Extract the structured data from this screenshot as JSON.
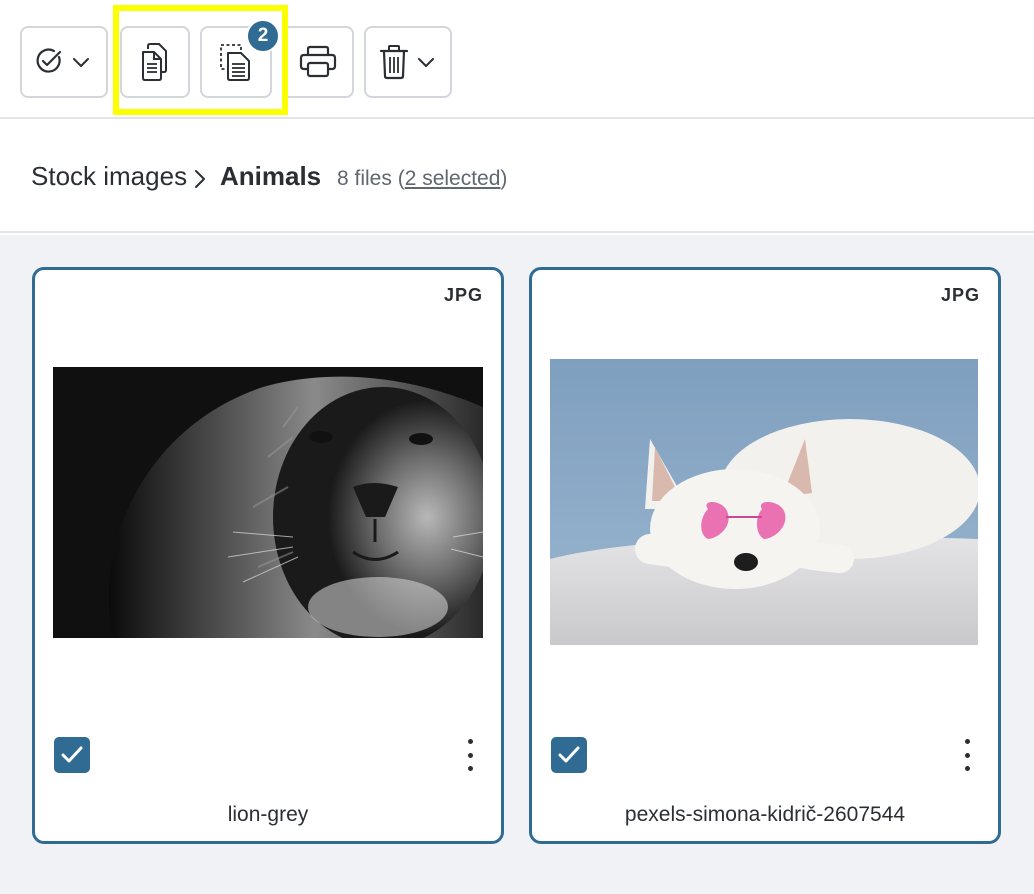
{
  "toolbar": {
    "buttons": [
      {
        "name": "select-all-button",
        "icon": "check-circle-icon",
        "has_dropdown": true
      },
      {
        "name": "copy-button",
        "icon": "copy-documents-icon"
      },
      {
        "name": "copy-selection-button",
        "icon": "dashed-copy-icon",
        "badge": "2"
      },
      {
        "name": "print-button",
        "icon": "printer-icon"
      },
      {
        "name": "delete-button",
        "icon": "trash-icon",
        "has_dropdown": true
      }
    ],
    "copy_selection_badge": "2",
    "highlight_color": "#fcff00"
  },
  "breadcrumb": {
    "root": "Stock images",
    "current": "Animals",
    "file_count": "8 files",
    "selected_text": "2 selected"
  },
  "files": [
    {
      "type": "JPG",
      "name": "lion-grey",
      "selected": true,
      "image": "lion-grey-photo"
    },
    {
      "type": "JPG",
      "name": "pexels-simona-kidrič-2607544",
      "selected": true,
      "image": "white-dog-pink-glasses-photo"
    }
  ],
  "colors": {
    "accent": "#2f6b93",
    "grid_bg": "#f0f2f5",
    "border": "#d3d6da"
  }
}
